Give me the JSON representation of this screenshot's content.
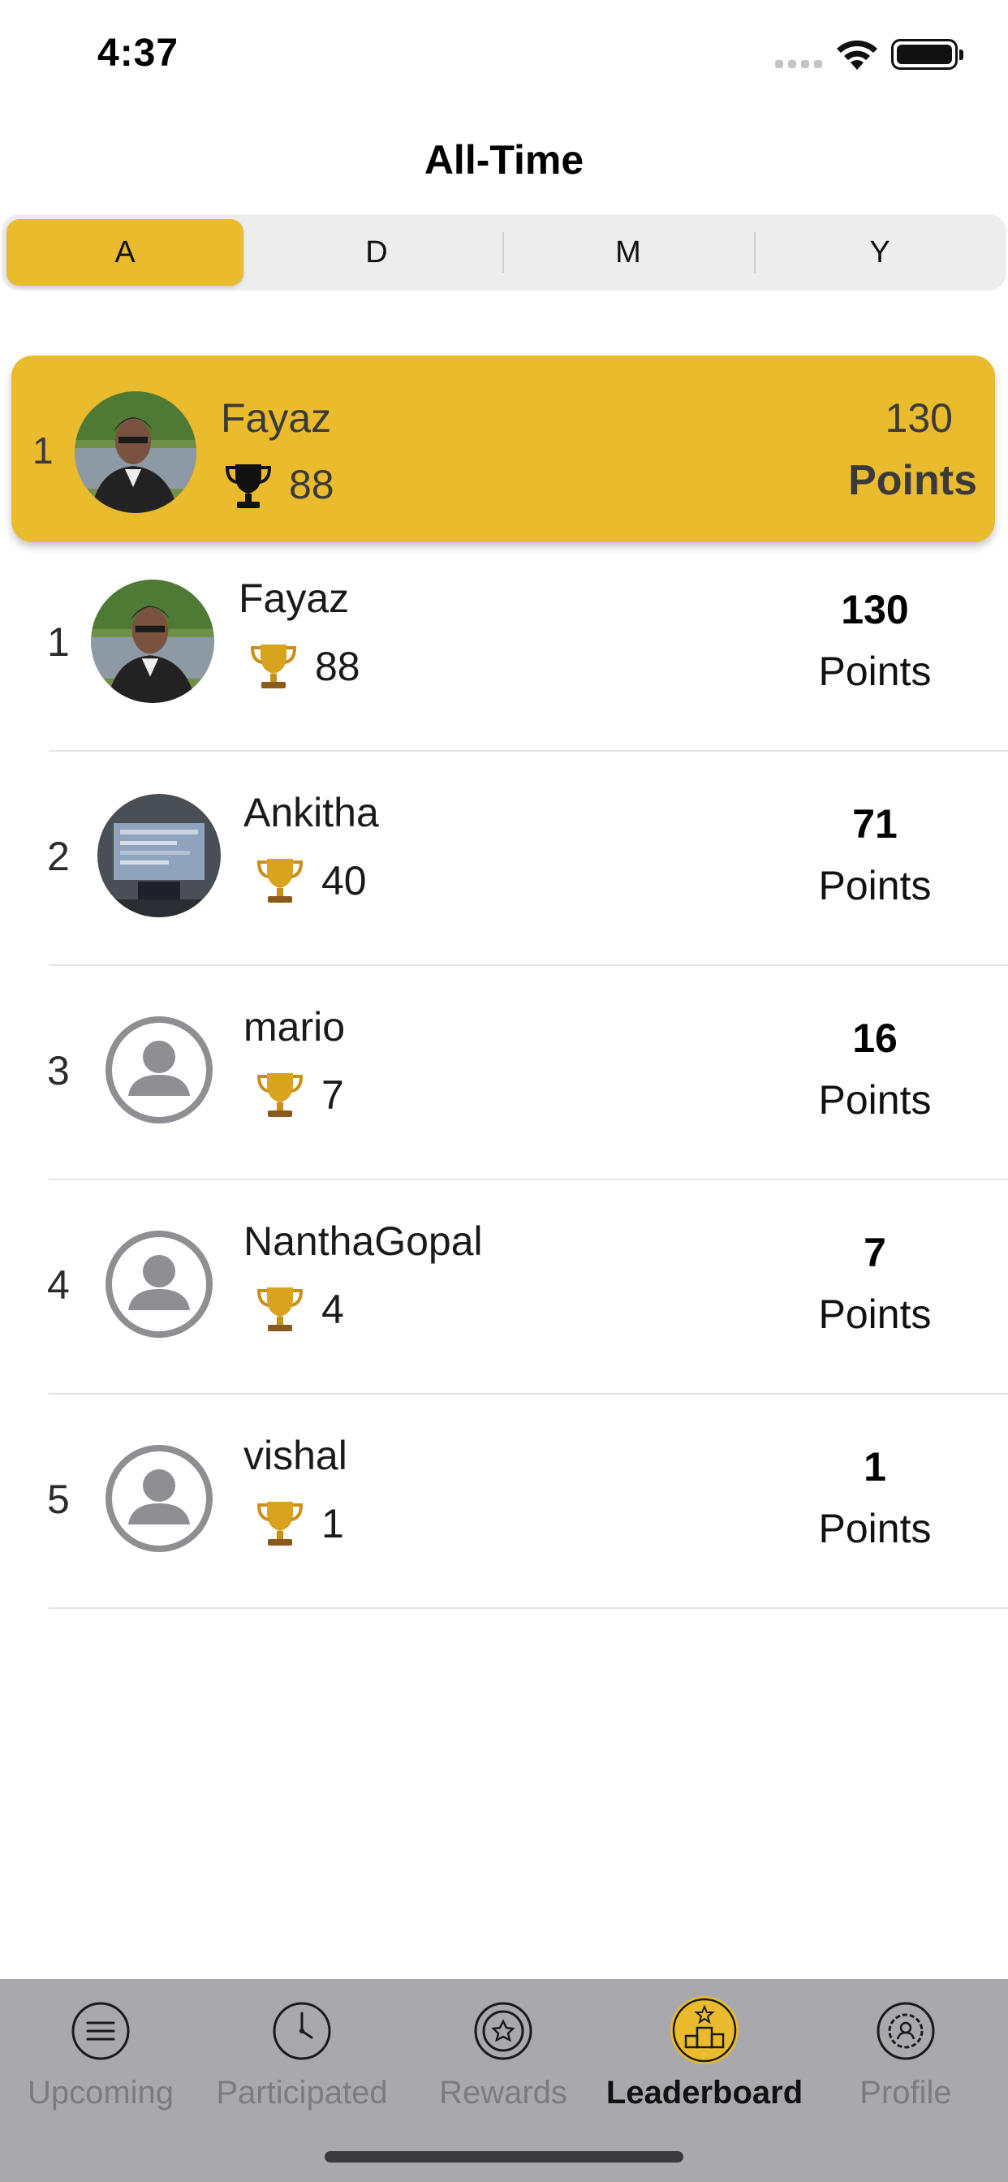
{
  "status_bar": {
    "time": "4:37"
  },
  "page": {
    "title": "All-Time"
  },
  "segments": [
    {
      "label": "A",
      "active": true
    },
    {
      "label": "D",
      "active": false
    },
    {
      "label": "M",
      "active": false
    },
    {
      "label": "Y",
      "active": false
    }
  ],
  "current_user": {
    "rank": "1",
    "name": "Fayaz",
    "trophies": "88",
    "points": "130",
    "points_label": "Points",
    "avatar": "photo"
  },
  "leaderboard": [
    {
      "rank": "1",
      "name": "Fayaz",
      "trophies": "88",
      "points": "130",
      "points_label": "Points",
      "avatar": "photo"
    },
    {
      "rank": "2",
      "name": "Ankitha",
      "trophies": "40",
      "points": "71",
      "points_label": "Points",
      "avatar": "photo"
    },
    {
      "rank": "3",
      "name": "mario",
      "trophies": "7",
      "points": "16",
      "points_label": "Points",
      "avatar": "placeholder"
    },
    {
      "rank": "4",
      "name": "NanthaGopal",
      "trophies": "4",
      "points": "7",
      "points_label": "Points",
      "avatar": "placeholder"
    },
    {
      "rank": "5",
      "name": "vishal",
      "trophies": "1",
      "points": "1",
      "points_label": "Points",
      "avatar": "placeholder"
    }
  ],
  "tabs": [
    {
      "label": "Upcoming",
      "icon": "list-icon",
      "active": false
    },
    {
      "label": "Participated",
      "icon": "clock-icon",
      "active": false
    },
    {
      "label": "Rewards",
      "icon": "reward-badge-icon",
      "active": false
    },
    {
      "label": "Leaderboard",
      "icon": "podium-icon",
      "active": true
    },
    {
      "label": "Profile",
      "icon": "profile-gear-icon",
      "active": false
    }
  ],
  "colors": {
    "accent": "#e9bb2d",
    "tab_bar_bg": "#a9a9ad",
    "inactive_tab": "#7c7c80"
  }
}
